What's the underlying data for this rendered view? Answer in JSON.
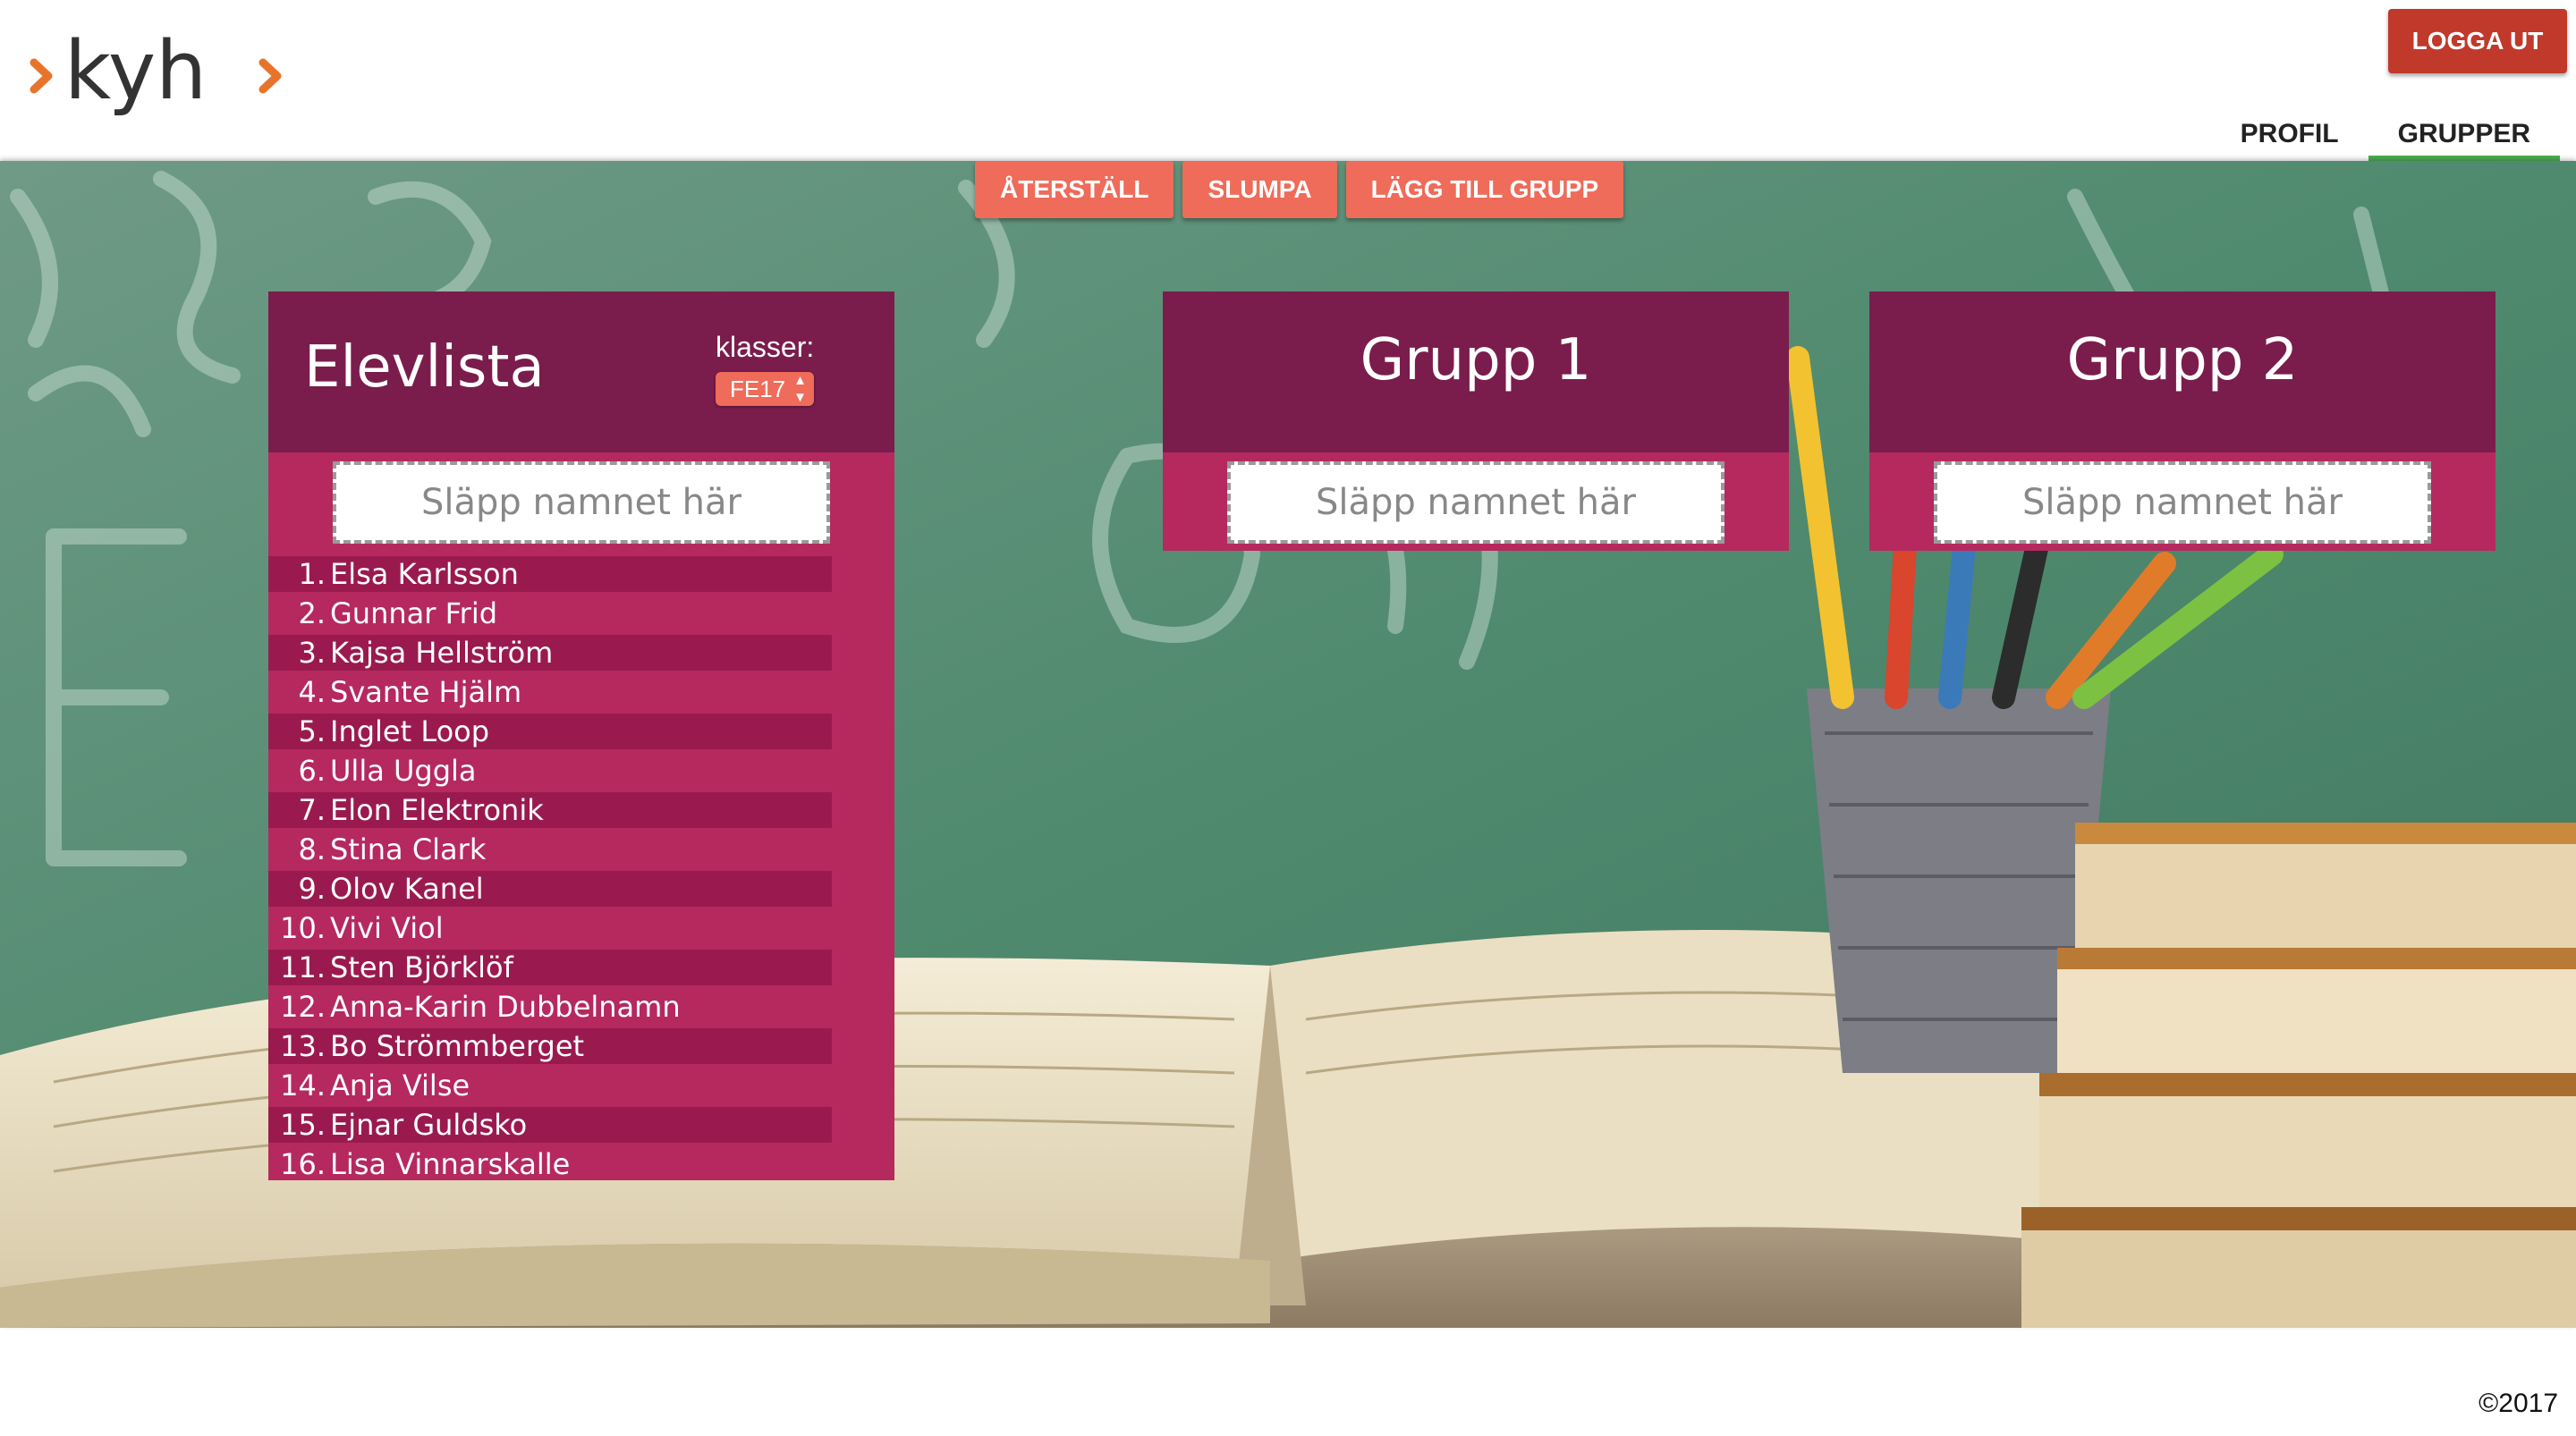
{
  "header": {
    "logo_text": "kyh",
    "logout_label": "LOGGA UT",
    "tabs": [
      {
        "label": "PROFIL",
        "active": false
      },
      {
        "label": "GRUPPER",
        "active": true
      }
    ]
  },
  "toolbar": {
    "reset_label": "ÅTERSTÄLL",
    "shuffle_label": "SLUMPA",
    "add_group_label": "LÄGG TILL GRUPP"
  },
  "student_panel": {
    "title": "Elevlista",
    "class_label": "klasser:",
    "class_selected": "FE17",
    "dropzone_text": "Släpp namnet här",
    "students": [
      {
        "num": "1.",
        "name": "Elsa Karlsson"
      },
      {
        "num": "2.",
        "name": "Gunnar Frid"
      },
      {
        "num": "3.",
        "name": "Kajsa Hellström"
      },
      {
        "num": "4.",
        "name": "Svante Hjälm"
      },
      {
        "num": "5.",
        "name": "Inglet Loop"
      },
      {
        "num": "6.",
        "name": "Ulla Uggla"
      },
      {
        "num": "7.",
        "name": "Elon Elektronik"
      },
      {
        "num": "8.",
        "name": "Stina Clark"
      },
      {
        "num": "9.",
        "name": "Olov Kanel"
      },
      {
        "num": "10.",
        "name": "Vivi Viol"
      },
      {
        "num": "11.",
        "name": "Sten Björklöf"
      },
      {
        "num": "12.",
        "name": "Anna-Karin Dubbelnamn"
      },
      {
        "num": "13.",
        "name": "Bo Strömmberget"
      },
      {
        "num": "14.",
        "name": "Anja Vilse"
      },
      {
        "num": "15.",
        "name": "Ejnar Guldsko"
      },
      {
        "num": "16.",
        "name": "Lisa Vinnarskalle"
      }
    ]
  },
  "groups": [
    {
      "title": "Grupp 1",
      "dropzone_text": "Släpp namnet här"
    },
    {
      "title": "Grupp 2",
      "dropzone_text": "Släpp namnet här"
    }
  ],
  "footer": {
    "copyright": "©2017"
  },
  "colors": {
    "card_header": "#7a1d4c",
    "card_body": "#b5295f",
    "row_stripe": "#9a1a4f",
    "accent_button": "#ef6b5a",
    "logout": "#c0392b",
    "active_tab_underline": "#4caf50",
    "logo_arrow": "#e8742c",
    "logo_text": "#333333"
  }
}
